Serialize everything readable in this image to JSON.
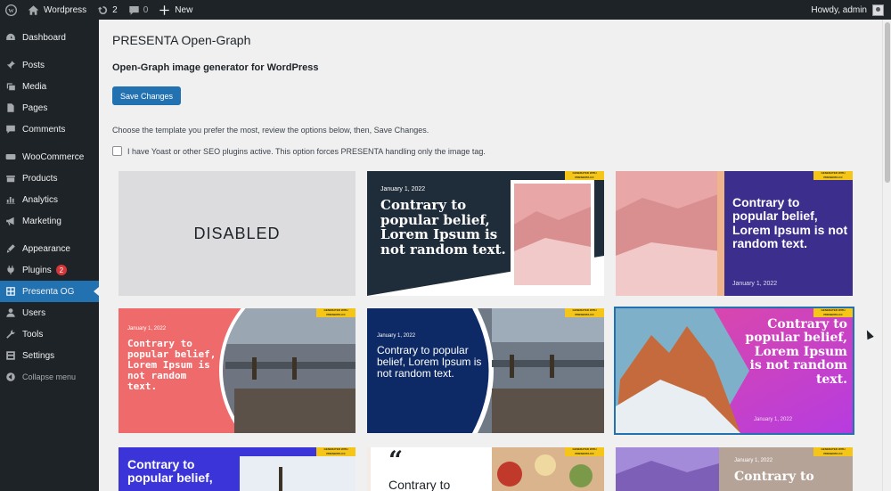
{
  "adminbar": {
    "site_name": "Wordpress",
    "updates_count": "2",
    "comments_count": "0",
    "new_label": "New",
    "howdy": "Howdy, admin"
  },
  "sidebar": {
    "items": [
      {
        "label": "Dashboard",
        "icon": "dashboard-icon"
      },
      {
        "label": "Posts",
        "icon": "pin-icon"
      },
      {
        "label": "Media",
        "icon": "media-icon"
      },
      {
        "label": "Pages",
        "icon": "page-icon"
      },
      {
        "label": "Comments",
        "icon": "comment-icon"
      },
      {
        "label": "WooCommerce",
        "icon": "woo-icon"
      },
      {
        "label": "Products",
        "icon": "box-icon"
      },
      {
        "label": "Analytics",
        "icon": "bar-chart-icon"
      },
      {
        "label": "Marketing",
        "icon": "megaphone-icon"
      },
      {
        "label": "Appearance",
        "icon": "brush-icon"
      },
      {
        "label": "Plugins",
        "icon": "plug-icon",
        "badge": "2"
      },
      {
        "label": "Presenta OG",
        "icon": "grid-icon"
      },
      {
        "label": "Users",
        "icon": "user-icon"
      },
      {
        "label": "Tools",
        "icon": "wrench-icon"
      },
      {
        "label": "Settings",
        "icon": "settings-icon"
      }
    ],
    "collapse_label": "Collapse menu"
  },
  "main": {
    "title": "PRESENTA Open-Graph",
    "subtitle": "Open-Graph image generator for WordPress",
    "save_label": "Save Changes",
    "description": "Choose the template you prefer the most, review the options below, then, Save Changes.",
    "checkbox_label": "I have Yoast or other SEO plugins active. This option forces PRESENTA handling only the image tag."
  },
  "templates": {
    "disabled_label": "DISABLED",
    "tag": "GENERATED WITH PRESENTA.CC",
    "date": "January 1, 2022",
    "headline": "Contrary to popular belief, Lorem Ipsum is not random text.",
    "headline_partial": "Contrary to popular belief,",
    "headline_short": "Contrary to",
    "quote_mark": "“"
  },
  "colors": {
    "accent": "#2271b1",
    "adminbar": "#1d2327",
    "badge": "#d63638",
    "tag": "#f5c518"
  }
}
